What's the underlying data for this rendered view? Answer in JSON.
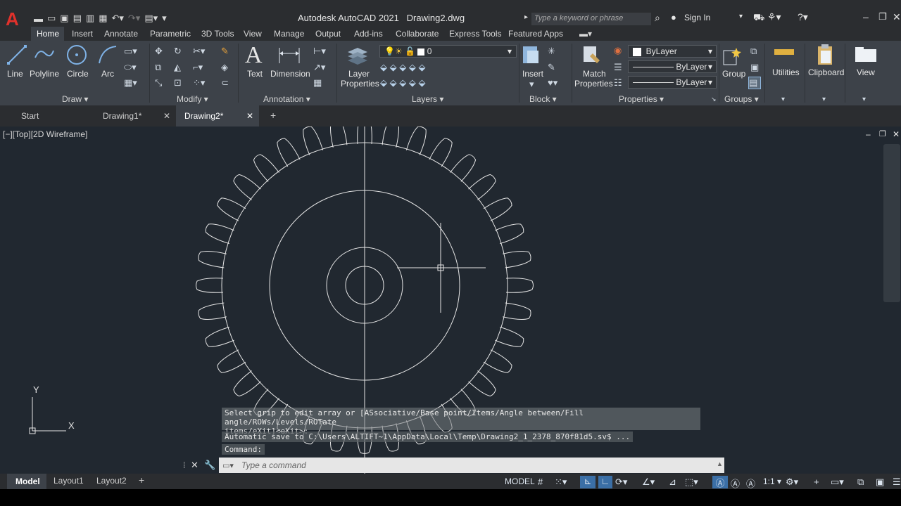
{
  "title_bar": {
    "app_title": "Autodesk AutoCAD 2021",
    "document": "Drawing2.dwg",
    "search_placeholder": "Type a keyword or phrase",
    "sign_in": "Sign In"
  },
  "menu_tabs": [
    "Home",
    "Insert",
    "Annotate",
    "Parametric",
    "3D Tools",
    "View",
    "Manage",
    "Output",
    "Add-ins",
    "Collaborate",
    "Express Tools",
    "Featured Apps"
  ],
  "ribbon": {
    "draw": {
      "title": "Draw",
      "tools": [
        "Line",
        "Polyline",
        "Circle",
        "Arc"
      ]
    },
    "modify": {
      "title": "Modify"
    },
    "annotation": {
      "title": "Annotation",
      "tools": [
        "Text",
        "Dimension"
      ]
    },
    "layers": {
      "title": "Layers",
      "tool": "Layer Properties",
      "current_layer": "0"
    },
    "block": {
      "title": "Block",
      "tool": "Insert"
    },
    "properties": {
      "title": "Properties",
      "tool": "Match Properties",
      "color": "ByLayer",
      "linetype": "ByLayer",
      "lineweight": "ByLayer"
    },
    "groups": {
      "title": "Groups",
      "tool": "Group"
    },
    "utilities": "Utilities",
    "clipboard": "Clipboard",
    "view": "View"
  },
  "doc_tabs": [
    "Start",
    "Drawing1*",
    "Drawing2*"
  ],
  "viewport_label": "[−][Top][2D Wireframe]",
  "ucs": {
    "x": "X",
    "y": "Y"
  },
  "command": {
    "history_line1": "Select grip to edit array or [ASsociative/Base point/Items/Angle between/Fill angle/ROWs/Levels/ROTate",
    "history_line2": "items/eXit]<eXit>:",
    "autosave": "Automatic save to C:\\Users\\ALTIFT~1\\AppData\\Local\\Temp\\Drawing2_1_2378_870f81d5.sv$ ...",
    "prompt": "Command:",
    "placeholder": "Type a command"
  },
  "status_bar": {
    "layouts": [
      "Model",
      "Layout1",
      "Layout2"
    ],
    "model_label": "MODEL",
    "scale": "1:1"
  },
  "colors": {
    "viewport_bg": "#212830",
    "ribbon_bg": "#3d4249",
    "titlebar_bg": "#2b2d30",
    "accent": "#3b8bd9",
    "logo_red": "#e0312b"
  }
}
